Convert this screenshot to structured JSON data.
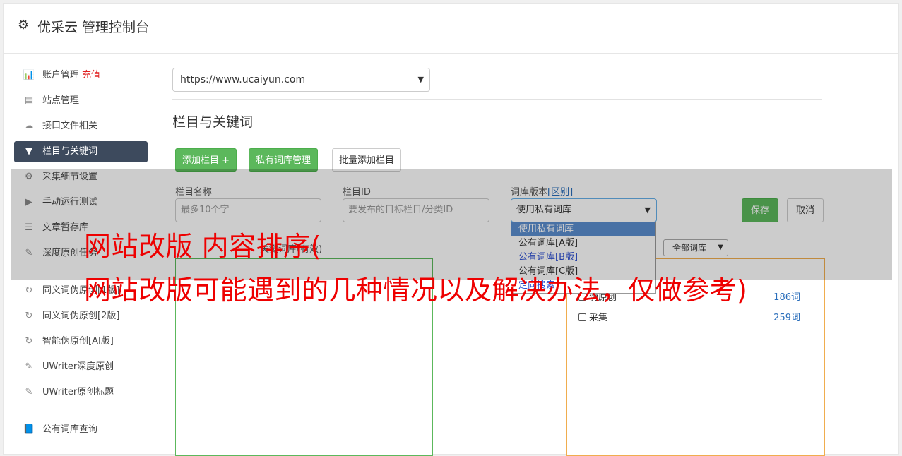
{
  "header": {
    "title": "优采云 管理控制台"
  },
  "sidebar": {
    "items": [
      {
        "label": "账户管理",
        "extra": "充值",
        "icon": "bar-chart-icon"
      },
      {
        "label": "站点管理",
        "icon": "server-icon"
      },
      {
        "label": "接口文件相关",
        "icon": "cloud-upload-icon"
      },
      {
        "label": "栏目与关键词",
        "icon": "filter-icon",
        "active": true
      },
      {
        "label": "采集细节设置",
        "icon": "gears-icon"
      },
      {
        "label": "手动运行测试",
        "icon": "play-circle-icon"
      },
      {
        "label": "文章暂存库",
        "icon": "database-icon"
      },
      {
        "label": "深度原创任务",
        "icon": "edit-icon"
      },
      {
        "label": "同义词伪原创[1版]",
        "icon": "refresh-icon"
      },
      {
        "label": "同义词伪原创[2版]",
        "icon": "refresh-icon"
      },
      {
        "label": "智能伪原创[AI版]",
        "icon": "refresh-icon"
      },
      {
        "label": "UWriter深度原创",
        "icon": "edit-icon"
      },
      {
        "label": "UWriter原创标题",
        "icon": "edit-icon"
      },
      {
        "label": "公有词库查询",
        "icon": "book-icon"
      }
    ]
  },
  "main": {
    "site_select": "https://www.ucaiyun.com",
    "section_title": "栏目与关键词",
    "buttons": {
      "add_column": "添加栏目 +",
      "private_lib": "私有词库管理",
      "batch_add": "批量添加栏目"
    },
    "form": {
      "column_name_label": "栏目名称",
      "column_name_placeholder": "最多10个字",
      "column_id_label": "栏目ID",
      "column_id_placeholder": "要发布的目标栏目/分类ID",
      "lib_version_label": "词库版本",
      "lib_version_link": "[区别]",
      "lib_version_value": "使用私有词库",
      "save": "保存",
      "cancel": "取消"
    },
    "dropdown_options": [
      "使用私有词库",
      "公有词库[A版]",
      "公有词库[B版]",
      "公有词库[C版]",
      "定向搜索"
    ],
    "all_lib_select": "全部词库",
    "left_panel_label": "关键词库(有效)",
    "word_list": [
      {
        "name": "伪原创",
        "count": "186词"
      },
      {
        "name": "采集",
        "count": "259词"
      }
    ]
  },
  "overlay": {
    "line1": "网站改版 内容排序(",
    "line2": "网站改版可能遇到的几种情况以及解决办法，仅做参考)"
  },
  "colors": {
    "accent": "#5cb85c",
    "active_nav": "#3d4a5d",
    "overlay_text": "#ee0000",
    "link": "#2a6ebb"
  }
}
